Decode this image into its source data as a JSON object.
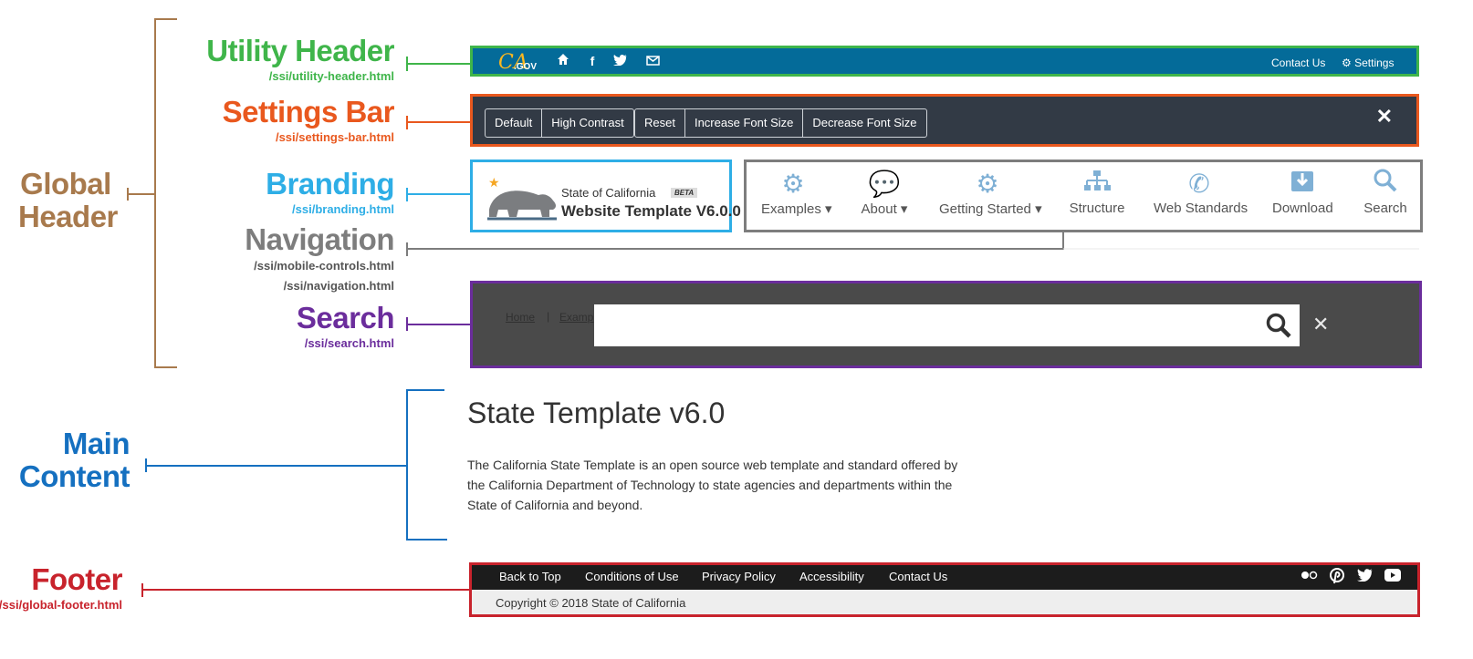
{
  "colors": {
    "utility": "#3fb54a",
    "settings": "#e9581e",
    "branding": "#2eaee6",
    "navigation": "#7d7d7d",
    "search": "#6b2d9c",
    "global": "#a87a4d",
    "main": "#1570c0",
    "footer": "#c8232c"
  },
  "labels": {
    "global_header": {
      "line1": "Global",
      "line2": "Header"
    },
    "utility": {
      "title": "Utility Header",
      "path": "/ssi/utility-header.html"
    },
    "settings": {
      "title": "Settings Bar",
      "path": "/ssi/settings-bar.html"
    },
    "branding": {
      "title": "Branding",
      "path": "/ssi/branding.html"
    },
    "navigation": {
      "title": "Navigation",
      "path1": "/ssi/mobile-controls.html",
      "path2": "/ssi/navigation.html"
    },
    "search": {
      "title": "Search",
      "path": "/ssi/search.html"
    },
    "main": {
      "line1": "Main",
      "line2": "Content"
    },
    "footer": {
      "title": "Footer",
      "path": "/ssi/global-footer.html"
    }
  },
  "utility_header": {
    "logo_text": "CA",
    "logo_gov": ".GOV",
    "icons": [
      "home-icon",
      "facebook-icon",
      "twitter-icon",
      "email-icon"
    ],
    "contact": "Contact Us",
    "settings": "Settings"
  },
  "settings_bar": {
    "group1": [
      "Default",
      "High Contrast"
    ],
    "group2": [
      "Reset",
      "Increase Font Size",
      "Decrease Font Size"
    ],
    "close": "✕"
  },
  "branding": {
    "state": "State of California",
    "beta": "BETA",
    "title": "Website Template V6.0.0"
  },
  "navigation": {
    "items": [
      {
        "label": "Examples",
        "icon": "gears-icon",
        "caret": true
      },
      {
        "label": "About",
        "icon": "chat-icon",
        "caret": true
      },
      {
        "label": "Getting Started",
        "icon": "gear-icon",
        "caret": true
      },
      {
        "label": "Structure",
        "icon": "sitemap-icon",
        "caret": false
      },
      {
        "label": "Web Standards",
        "icon": "phone-icon",
        "caret": false
      },
      {
        "label": "Download",
        "icon": "download-icon",
        "caret": false
      },
      {
        "label": "Search",
        "icon": "search-icon",
        "caret": false
      }
    ]
  },
  "search": {
    "crumb_home": "Home",
    "crumb_examples": "Examp",
    "close": "✕"
  },
  "main": {
    "title": "State Template v6.0",
    "body": "The California State Template is an open source web template and standard offered by the California Department of Technology to state agencies and departments within the State of California and beyond."
  },
  "footer": {
    "links": [
      "Back to Top",
      "Conditions of Use",
      "Privacy Policy",
      "Accessibility",
      "Contact Us"
    ],
    "social": [
      "flickr-icon",
      "pinterest-icon",
      "twitter-icon",
      "youtube-icon"
    ],
    "copyright": "Copyright © 2018 State of California"
  }
}
